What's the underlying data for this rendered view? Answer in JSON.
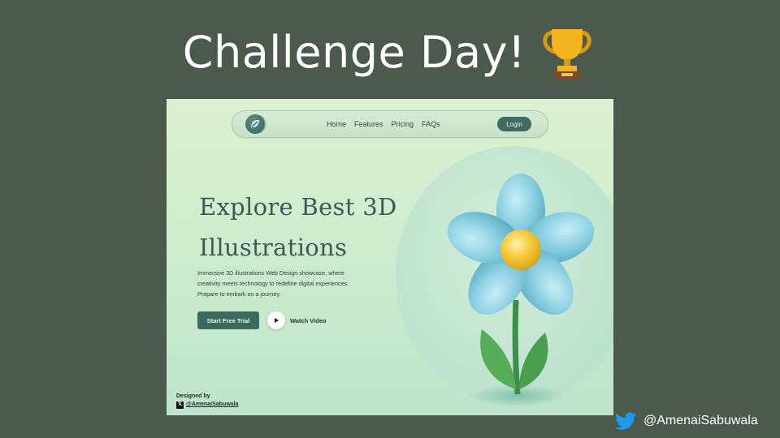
{
  "slide": {
    "title": "Challenge Day!",
    "trophy_icon": "trophy-icon",
    "credit_handle": "@AmenaiSabuwala",
    "credit_icon": "twitter-bird-icon",
    "background_color": "#4b5a4c"
  },
  "mockup": {
    "nav": {
      "logo_icon": "leaf-logo-icon",
      "links": [
        "Home",
        "Features",
        "Pricing",
        "FAQs"
      ],
      "login_label": "Login"
    },
    "hero": {
      "title_line1": "Explore Best 3D",
      "title_line2": "Illustrations",
      "desc_line1": "Immersive 3D illustrations Web Design showcase, where",
      "desc_line2": "creativity meets technology to redefine digital experiences.",
      "desc_line3": "Prepare to embark on a journey.",
      "cta_label": "Start Free Trial",
      "watch_label": "Watch Video",
      "play_icon": "play-icon",
      "illustration": "3d-flower-illustration"
    },
    "footer": {
      "designed_by": "Designed by",
      "x_icon": "x-logo-icon",
      "handle": "@AmenaiSabuwala"
    },
    "colors": {
      "accent": "#3c6a60",
      "background": "#cfeccd",
      "petal": "#7fc6d8",
      "flower_center": "#f2c23a"
    }
  }
}
